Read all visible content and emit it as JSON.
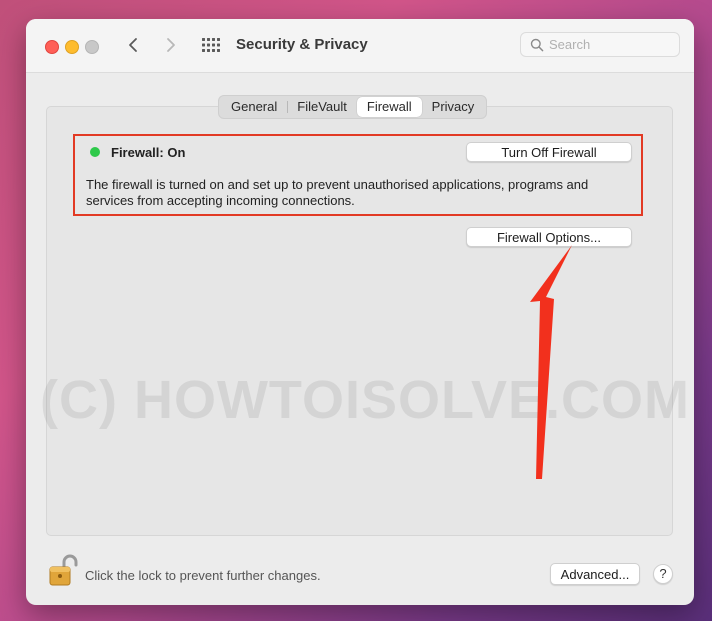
{
  "window": {
    "title": "Security & Privacy",
    "search": {
      "placeholder": "Search",
      "value": ""
    }
  },
  "tabs": [
    {
      "label": "General",
      "active": false
    },
    {
      "label": "FileVault",
      "active": false
    },
    {
      "label": "Firewall",
      "active": true
    },
    {
      "label": "Privacy",
      "active": false
    }
  ],
  "firewall": {
    "status": "Firewall: On",
    "status_color": "#2ec94a",
    "turn_off_label": "Turn Off Firewall",
    "description": "The firewall is turned on and set up to prevent unauthorised applications, programs and services from accepting incoming connections.",
    "options_label": "Firewall Options..."
  },
  "footer": {
    "lock_text": "Click the lock to prevent further changes.",
    "advanced_label": "Advanced...",
    "help_label": "?"
  },
  "watermark": "(C) HOWTOISOLVE.COM",
  "colors": {
    "highlight": "#e23a24",
    "arrow": "#f2301d"
  },
  "icons": [
    "close-icon",
    "minimize-icon",
    "zoom-icon",
    "chevron-left-icon",
    "chevron-right-icon",
    "grid-icon",
    "search-icon",
    "lock-icon",
    "arrow-annotation"
  ]
}
